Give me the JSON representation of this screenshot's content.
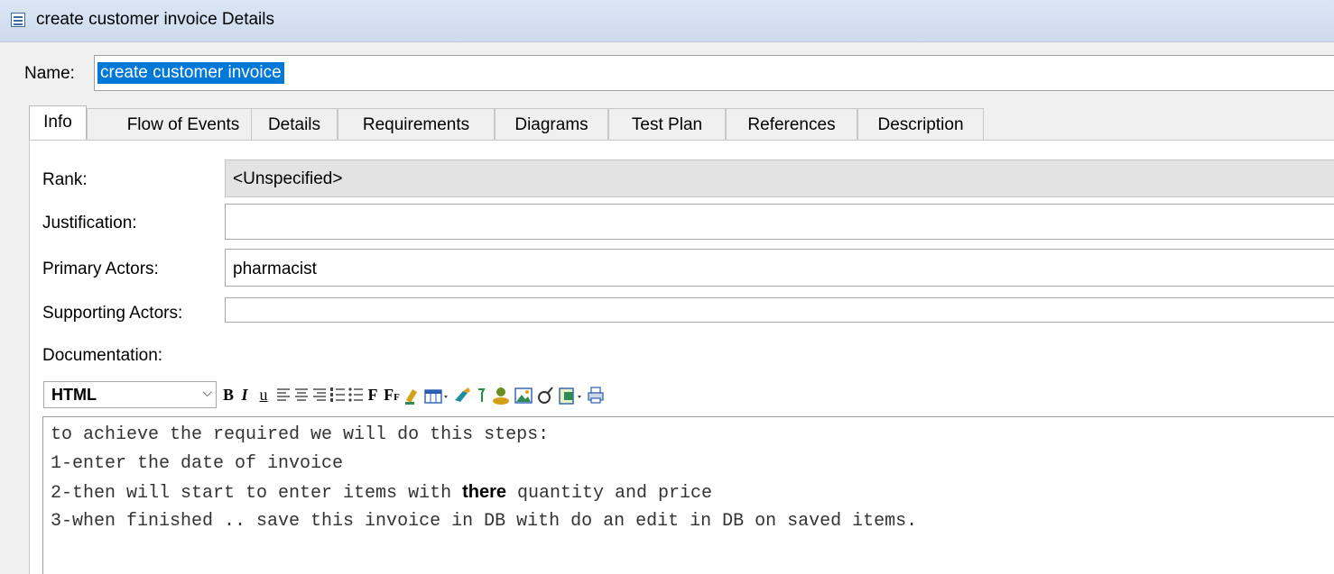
{
  "window": {
    "title": "create customer invoice Details"
  },
  "name": {
    "label": "Name:",
    "value": "create customer invoice"
  },
  "tabs": [
    {
      "label": "Info"
    },
    {
      "label": "Flow of Events"
    },
    {
      "label": "Details"
    },
    {
      "label": "Requirements"
    },
    {
      "label": "Diagrams"
    },
    {
      "label": "Test Plan"
    },
    {
      "label": "References"
    },
    {
      "label": "Description"
    }
  ],
  "info": {
    "rank": {
      "label": "Rank:",
      "value": "<Unspecified>"
    },
    "justification": {
      "label": "Justification:",
      "value": ""
    },
    "primary_actors": {
      "label": "Primary Actors:",
      "value": "pharmacist"
    },
    "supporting_actors": {
      "label": "Supporting Actors:",
      "value": ""
    },
    "documentation_label": "Documentation:"
  },
  "editor": {
    "format": "HTML",
    "toolbar": {
      "bold": "B",
      "italic": "I",
      "underline": "u",
      "font": "F",
      "font_size": "F",
      "icons": [
        "align-left-icon",
        "align-center-icon",
        "align-right-icon",
        "numbered-list-icon",
        "bullet-list-icon",
        "highlight-icon",
        "table-icon",
        "link-icon",
        "anchor-icon",
        "user-icon",
        "image-icon",
        "symbol-icon",
        "template-icon",
        "print-icon"
      ]
    },
    "lines": [
      "to achieve the required we will do this steps:",
      "1-enter the date of invoice",
      {
        "pre": "2-then will start to enter items with ",
        "bold": "there",
        "post": " quantity and price"
      },
      "3-when finished .. save this invoice in DB with do an edit in DB on saved items."
    ]
  },
  "colors": {
    "selection": "#0078d7",
    "titlebar": "#cddbee"
  }
}
